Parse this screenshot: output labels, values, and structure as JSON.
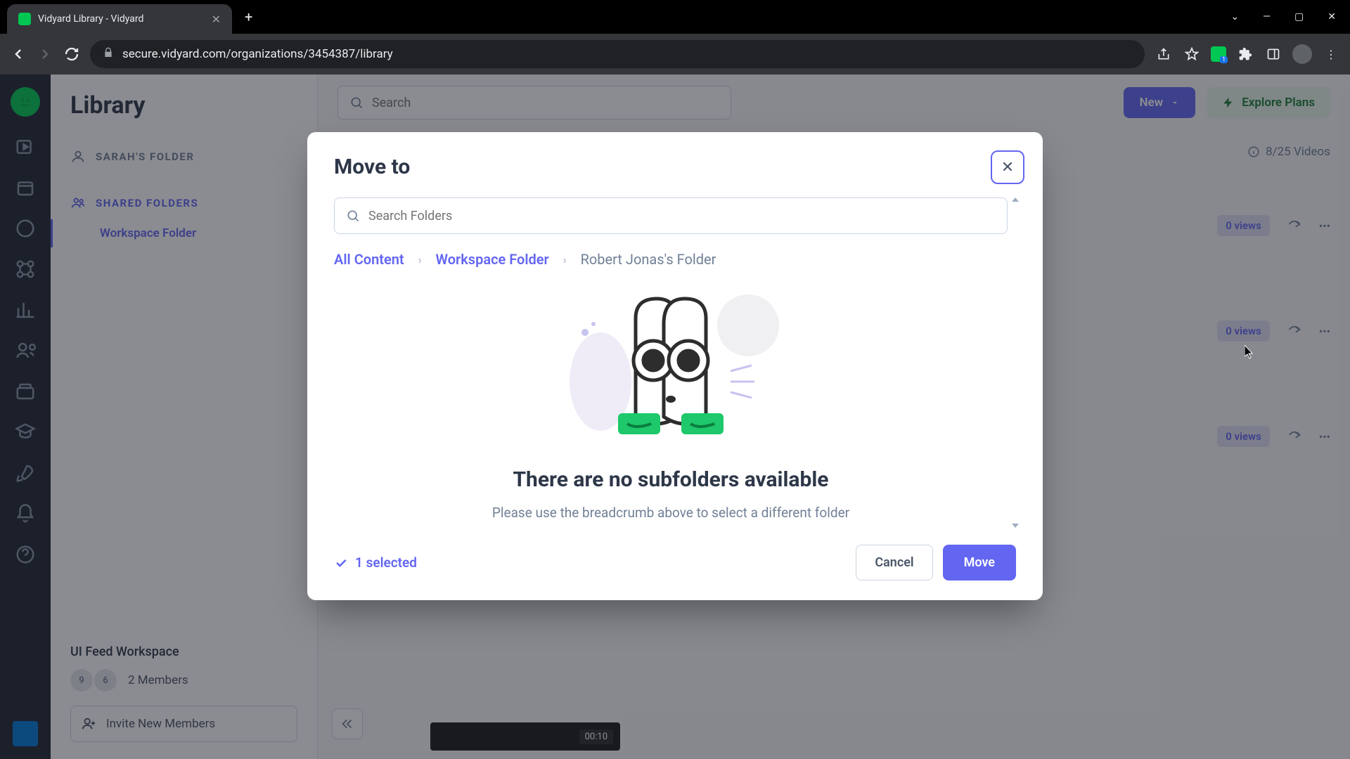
{
  "browser": {
    "tab_title": "Vidyard Library - Vidyard",
    "url": "secure.vidyard.com/organizations/3454387/library"
  },
  "header": {
    "page_title": "Library",
    "search_placeholder": "Search",
    "new_label": "New",
    "explore_label": "Explore Plans",
    "video_count": "8/25 Videos"
  },
  "sidebar": {
    "user_folder_label": "SARAH'S FOLDER",
    "shared_label": "SHARED FOLDERS",
    "shared_items": [
      {
        "label": "Workspace Folder"
      }
    ],
    "workspace_name": "UI Feed Workspace",
    "avatars": [
      "9",
      "6"
    ],
    "members_text": "2 Members",
    "invite_label": "Invite New Members"
  },
  "video_rows": [
    {
      "views": "0 views"
    },
    {
      "views": "0 views"
    },
    {
      "views": "0 views"
    }
  ],
  "thumb_time": "00:10",
  "modal": {
    "title": "Move to",
    "search_placeholder": "Search Folders",
    "breadcrumb": [
      {
        "label": "All Content",
        "current": false
      },
      {
        "label": "Workspace Folder",
        "current": false
      },
      {
        "label": "Robert Jonas's Folder",
        "current": true
      }
    ],
    "empty_title": "There are no subfolders available",
    "empty_sub": "Please use the breadcrumb above to select a different folder",
    "selected": "1 selected",
    "cancel": "Cancel",
    "move": "Move"
  }
}
